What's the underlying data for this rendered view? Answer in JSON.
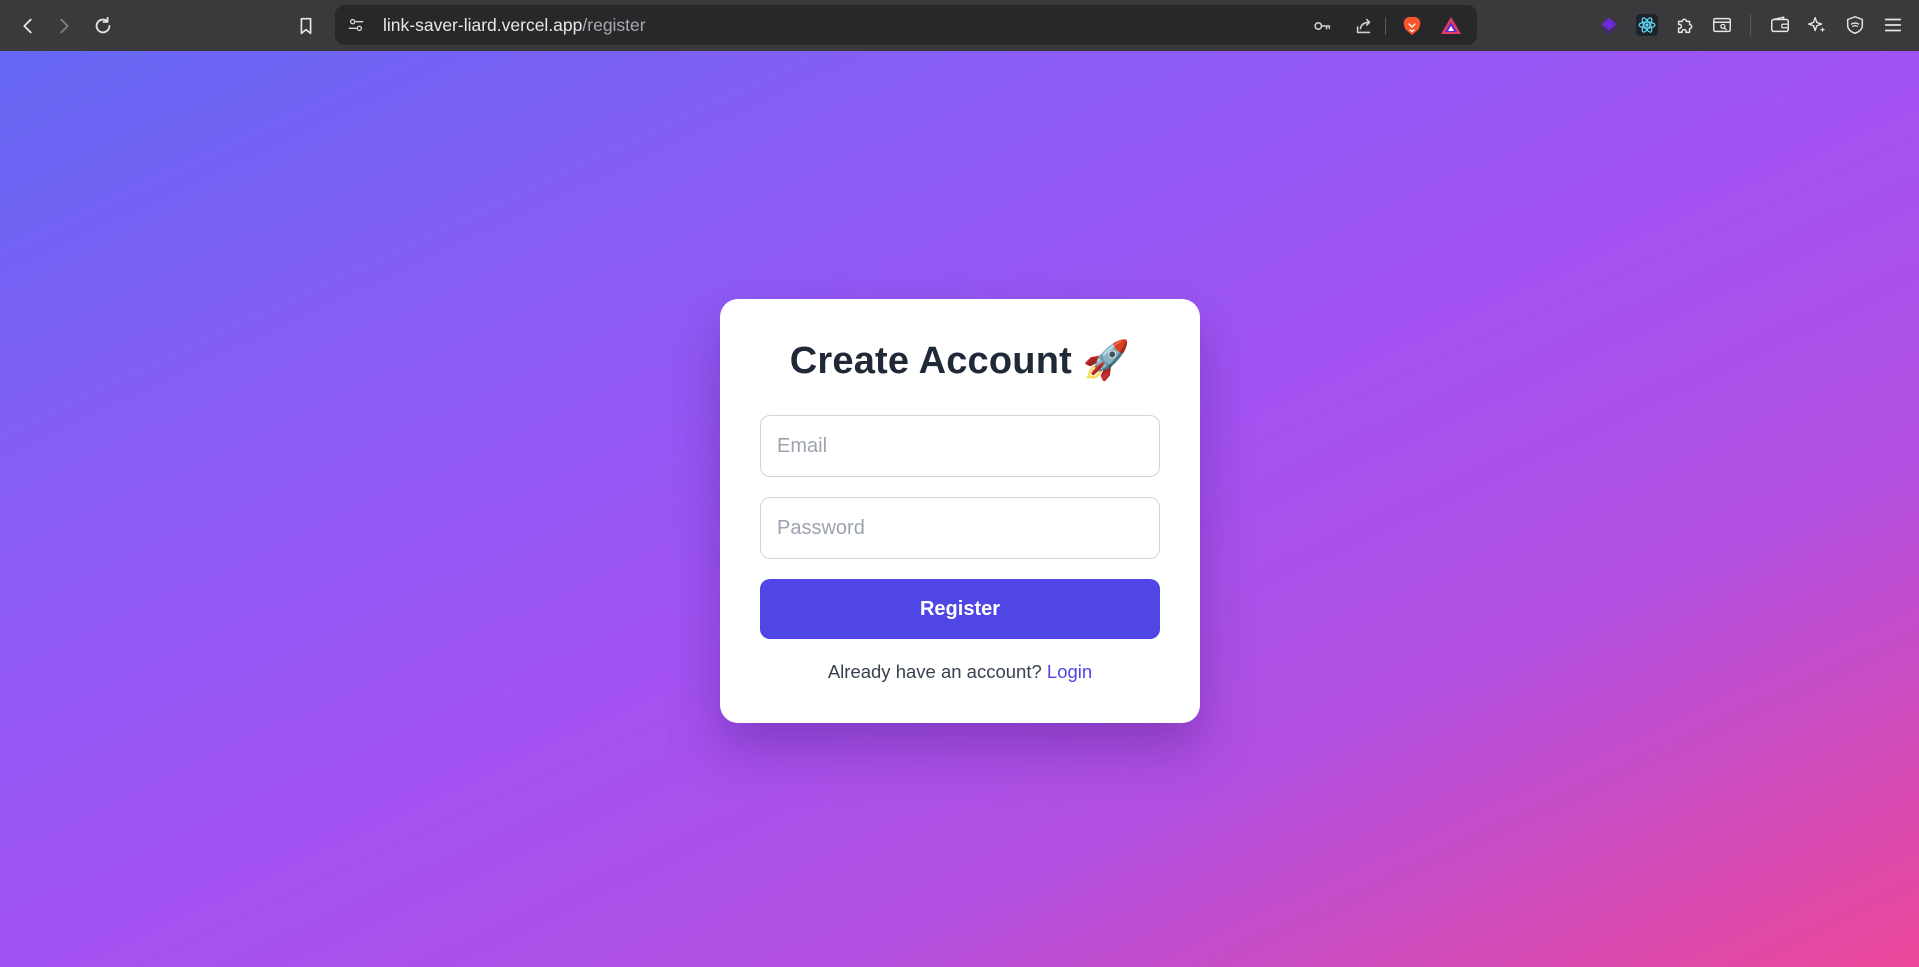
{
  "browser": {
    "url_host": "link-saver-liard.vercel.app",
    "url_path": "/register",
    "icons": {
      "back": "back-arrow-icon",
      "forward": "forward-arrow-icon",
      "reload": "reload-icon",
      "bookmark": "bookmark-icon",
      "site_settings": "tune-icon",
      "password": "key-icon",
      "share": "share-icon",
      "brave_shields": "brave-lion-icon",
      "rewards": "brave-rewards-icon",
      "extensions": [
        "layers-extension-icon",
        "react-devtools-icon",
        "puzzle-extensions-icon",
        "inspect-extension-icon"
      ],
      "wallet": "wallet-icon",
      "leo_ai": "sparkle-icon",
      "vpn": "shield-icon",
      "menu": "hamburger-menu-icon"
    }
  },
  "card": {
    "title": "Create Account 🚀",
    "email_placeholder": "Email",
    "password_placeholder": "Password",
    "submit_label": "Register",
    "footer_text": "Already have an account? ",
    "footer_link": "Login"
  },
  "colors": {
    "gradient_start": "#6467f2",
    "gradient_mid": "#a352f1",
    "gradient_end": "#ec4899",
    "button": "#4f46e5",
    "link": "#4f46e5",
    "title": "#1f2937"
  }
}
